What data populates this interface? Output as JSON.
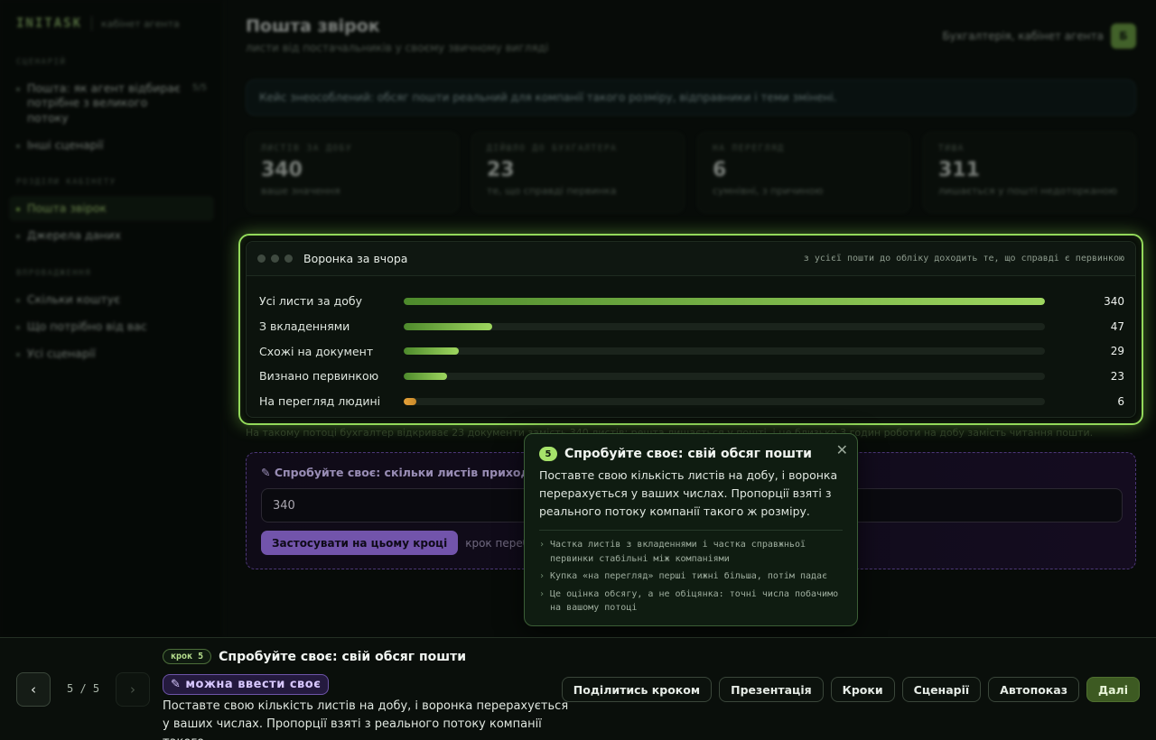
{
  "brand": {
    "logo": "INITASK",
    "subtitle": "кабінет агента"
  },
  "sidebar": {
    "sections": [
      {
        "label": "СЦЕНАРІЙ",
        "items": [
          {
            "label": "Пошта: як агент відбирає потрібне з великого потоку",
            "count": "5/5",
            "active": false
          },
          {
            "label": "Інші сценарії",
            "count": "",
            "active": false
          }
        ]
      },
      {
        "label": "РОЗДІЛИ КАБІНЕТУ",
        "items": [
          {
            "label": "Пошта звірок",
            "count": "",
            "active": true
          },
          {
            "label": "Джерела даних",
            "count": "",
            "active": false
          }
        ]
      },
      {
        "label": "ВПРОВАДЖЕННЯ",
        "items": [
          {
            "label": "Скільки коштує",
            "count": "",
            "active": false
          },
          {
            "label": "Що потрібно від вас",
            "count": "",
            "active": false
          },
          {
            "label": "Усі сценарії",
            "count": "",
            "active": false
          }
        ]
      }
    ]
  },
  "header": {
    "title": "Пошта звірок",
    "subtitle": "листи від постачальників у своєму звичному вигляді",
    "user": "Бухгалтерія, кабінет агента",
    "avatar": "Б"
  },
  "notice": "Кейс знеособлений: обсяг пошти реальний для компанії такого розміру, відправники і теми змінені.",
  "stats": [
    {
      "label": "ЛИСТІВ ЗА ДОБУ",
      "value": "340",
      "desc": "ваше значення"
    },
    {
      "label": "ДІЙШЛО ДО БУХГАЛТЕРА",
      "value": "23",
      "desc": "те, що справді первинка"
    },
    {
      "label": "НА ПЕРЕГЛЯД",
      "value": "6",
      "desc": "сумнівні, з причиною"
    },
    {
      "label": "ТИША",
      "value": "311",
      "desc": "лишається у пошті недоторканою"
    }
  ],
  "funnel": {
    "title": "Воронка за вчора",
    "note": "з усієї пошти до обліку доходить те, що справді є первинкою",
    "max": 340,
    "rows": [
      {
        "label": "Усі листи за добу",
        "value": 340,
        "display": "340",
        "warn": false
      },
      {
        "label": "З вкладеннями",
        "value": 47,
        "display": "47",
        "warn": false
      },
      {
        "label": "Схожі на документ",
        "value": 29,
        "display": "29",
        "warn": false
      },
      {
        "label": "Визнано первинкою",
        "value": 23,
        "display": "23",
        "warn": false
      },
      {
        "label": "На перегляд людині",
        "value": 6,
        "display": "6",
        "warn": true
      }
    ],
    "footer": "На такому потоці бухгалтер відкриває 23 документи замість 340 листів; решта лишається у пошті, і це близько 3 годин роботи на добу замість читання пошти."
  },
  "try": {
    "title": "✎ Спробуйте своє: скільки листів приходить на добу",
    "value": "340",
    "apply": "Застосувати на цьому кроці",
    "hint": "крок перебудується під ваше число"
  },
  "popover": {
    "num": "5",
    "title": "Спробуйте своє: свій обсяг пошти",
    "text": "Поставте свою кількість листів на добу, і воронка перерахується у ваших числах. Пропорції взяті з реального потоку компанії такого ж розміру.",
    "close": "✕",
    "bullets": [
      "Частка листів з вкладеннями і частка справжньої первинки стабільні між компаніями",
      "Купка «на перегляд» перші тижні більша, потім падає",
      "Це оцінка обсягу, а не обіцянка: точні числа побачимо на вашому потоці"
    ]
  },
  "bottom": {
    "prev": "‹",
    "next": "›",
    "counter": "5 / 5",
    "step_badge": "крок 5",
    "step_title": "Спробуйте своє: свій обсяг пошти",
    "edit_badge": "✎ можна ввести своє",
    "desc": "Поставте свою кількість листів на добу, і воронка перерахується у ваших числах. Пропорції взяті з реального потоку компанії такого…",
    "actions": [
      "Поділитись кроком",
      "Презентація",
      "Кроки",
      "Сценарії",
      "Автопоказ"
    ],
    "primary": "Далі"
  }
}
